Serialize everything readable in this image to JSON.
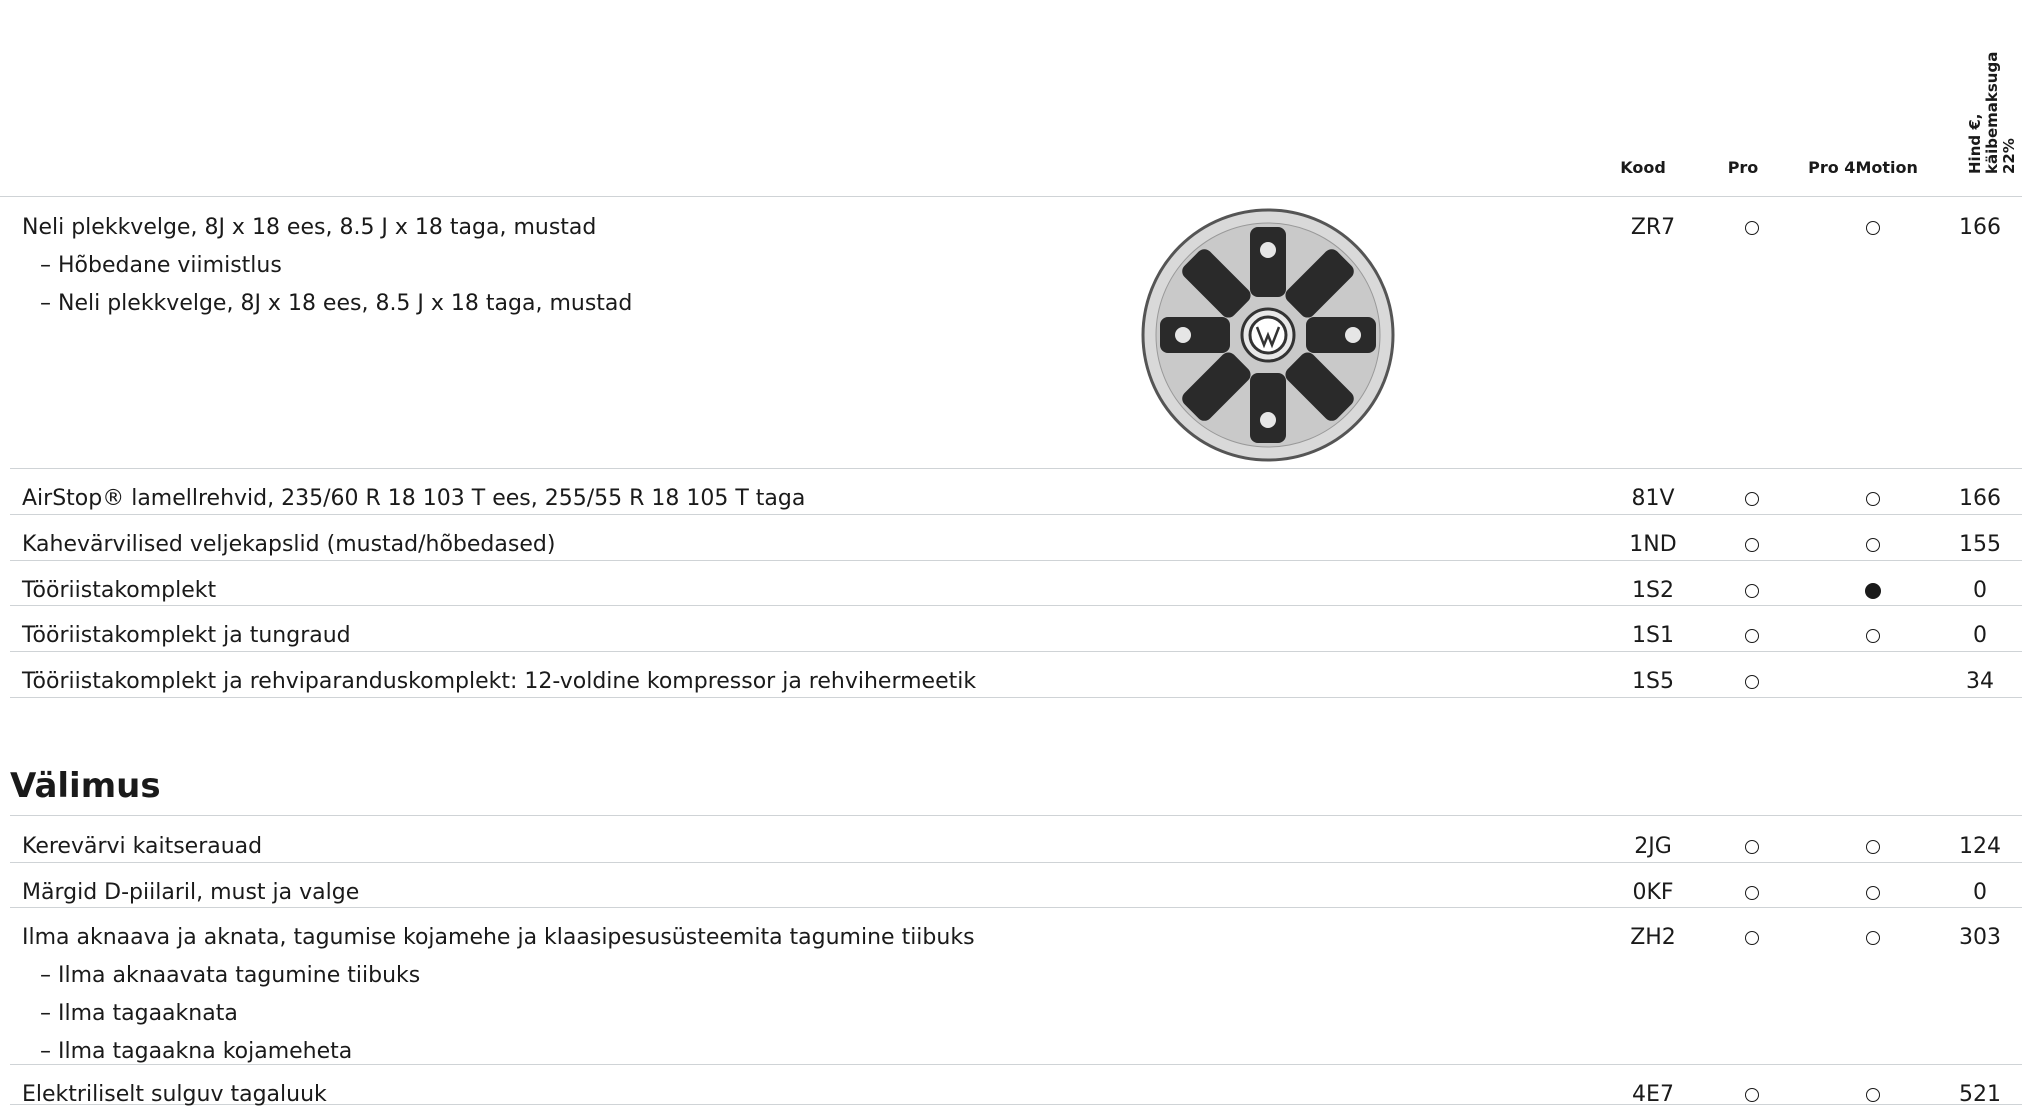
{
  "header": {
    "code": "Kood",
    "pro": "Pro",
    "pro4motion": "Pro 4Motion",
    "price": "Hind €, käibemaksuga 22%"
  },
  "rows_top": [
    {
      "desc": "Neli plekkvelge, 8J x 18 ees, 8.5 J x 18 taga, mustad",
      "subs": [
        "– Hõbedane viimistlus",
        "– Neli plekkvelge, 8J x 18 ees, 8.5 J x 18 taga, mustad"
      ],
      "code": "ZR7",
      "pro": "open",
      "pro4motion": "open",
      "price": "166"
    },
    {
      "desc": "AirStop® lamellrehvid, 235/60 R 18 103 T ees, 255/55 R 18 105 T taga",
      "code": "81V",
      "pro": "open",
      "pro4motion": "open",
      "price": "166"
    },
    {
      "desc": "Kahevärvilised veljekapslid (mustad/hõbedased)",
      "code": "1ND",
      "pro": "open",
      "pro4motion": "open",
      "price": "155"
    },
    {
      "desc": "Tööriistakomplekt",
      "code": "1S2",
      "pro": "open",
      "pro4motion": "filled",
      "price": "0"
    },
    {
      "desc": "Tööriistakomplekt ja tungraud",
      "code": "1S1",
      "pro": "open",
      "pro4motion": "open",
      "price": "0"
    },
    {
      "desc": "Tööriistakomplekt ja rehviparanduskomplekt: 12-voldine kompressor ja rehvihermeetik",
      "code": "1S5",
      "pro": "open",
      "pro4motion": "",
      "price": "34"
    }
  ],
  "section_title": "Välimus",
  "rows_bottom": [
    {
      "desc": "Kerevärvi kaitserauad",
      "code": "2JG",
      "pro": "open",
      "pro4motion": "open",
      "price": "124"
    },
    {
      "desc": "Märgid D-piilaril, must ja valge",
      "code": "0KF",
      "pro": "open",
      "pro4motion": "open",
      "price": "0"
    },
    {
      "desc": "Ilma aknaava ja aknata, tagumise kojamehe ja klaasipesusüsteemita tagumine tiibuks",
      "subs": [
        "– Ilma aknaavata tagumine tiibuks",
        "– Ilma tagaaknata",
        "– Ilma tagaakna kojameheta"
      ],
      "code": "ZH2",
      "pro": "open",
      "pro4motion": "open",
      "price": "303"
    },
    {
      "desc": "Elektriliselt sulguv tagaluuk",
      "code": "4E7",
      "pro": "open",
      "pro4motion": "open",
      "price": "521"
    }
  ],
  "image": {
    "icon": "wheel-cover-icon"
  }
}
